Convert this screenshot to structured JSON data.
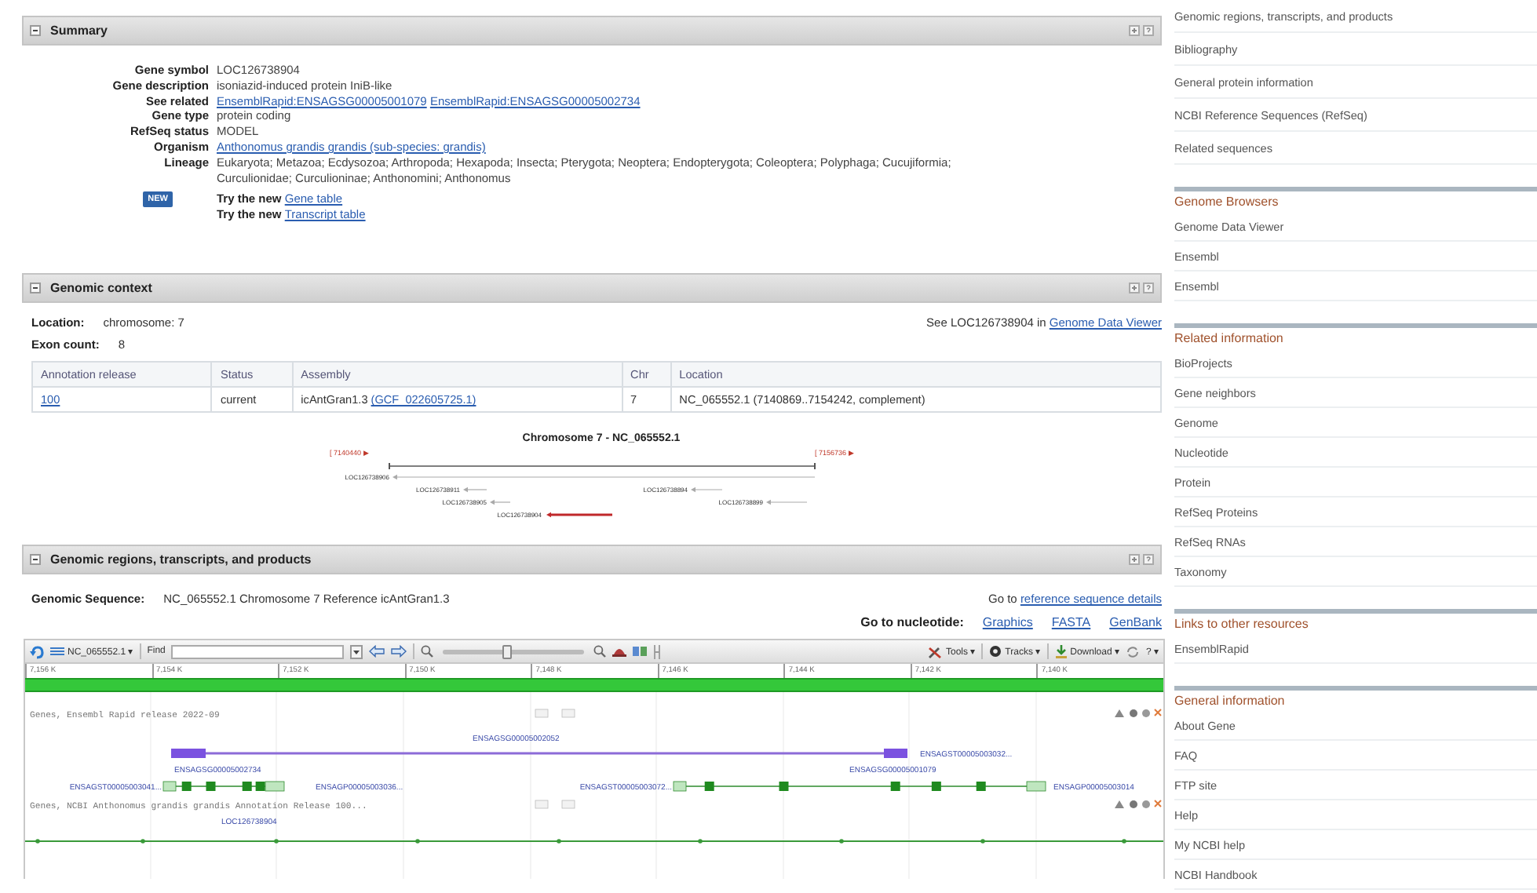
{
  "summary": {
    "title": "Summary",
    "fields": [
      {
        "label": "Gene symbol",
        "kind": "text",
        "value": "LOC126738904"
      },
      {
        "label": "Gene description",
        "kind": "text",
        "value": "isoniazid-induced protein IniB-like"
      },
      {
        "label": "See related",
        "kind": "links",
        "links": [
          "EnsemblRapid:ENSAGSG00005001079",
          "EnsemblRapid:ENSAGSG00005002734"
        ]
      },
      {
        "label": "Gene type",
        "kind": "text",
        "value": "protein coding"
      },
      {
        "label": "RefSeq status",
        "kind": "text",
        "value": "MODEL"
      },
      {
        "label": "Organism",
        "kind": "links",
        "links": [
          "Anthonomus grandis grandis (sub-species: grandis)"
        ]
      },
      {
        "label": "Lineage",
        "kind": "text",
        "value": "Eukaryota; Metazoa; Ecdysozoa; Arthropoda; Hexapoda; Insecta; Pterygota; Neoptera; Endopterygota; Coleoptera; Polyphaga; Cucujiformia; Curculionidae; Curculioninae; Anthonomini; Anthonomus"
      }
    ],
    "badge": "NEW",
    "try_links": [
      {
        "prefix": "Try the new",
        "link": "Gene table"
      },
      {
        "prefix": "Try the new",
        "link": "Transcript table"
      }
    ]
  },
  "genomic_context": {
    "title": "Genomic context",
    "location_label": "Location:",
    "location": "chromosome: 7",
    "exon_label": "Exon count:",
    "exon_count": "8",
    "see_text": "See LOC126738904 in",
    "see_link": "Genome Data Viewer",
    "table": {
      "columns": [
        "Annotation release",
        "Status",
        "Assembly",
        "Chr",
        "Location"
      ],
      "rows": [
        {
          "release": "100",
          "status": "current",
          "assembly": "icAntGran1.3",
          "assembly_link": "(GCF_022605725.1)",
          "chr": "7",
          "location": "NC_065552.1 (7140869..7154242, complement)"
        }
      ]
    },
    "diagram": {
      "title": "Chromosome 7 - NC_065552.1",
      "left_range": "[ 7140440 ▶",
      "right_range": "[ 7156736 ▶",
      "genes": [
        {
          "label": "LOC126738906",
          "selected": false
        },
        {
          "label": "LOC126738911",
          "selected": false
        },
        {
          "label": "LOC126738894",
          "selected": false
        },
        {
          "label": "LOC126738905",
          "selected": false
        },
        {
          "label": "LOC126738899",
          "selected": false
        },
        {
          "label": "LOC126738904",
          "selected": true
        }
      ]
    }
  },
  "genomic_regions": {
    "title": "Genomic regions, transcripts, and products",
    "seq_label": "Genomic Sequence:",
    "seq_value": "NC_065552.1 Chromosome 7 Reference icAntGran1.3",
    "goto_prefix": "Go to",
    "goto_link": "reference sequence details",
    "nuc_label": "Go to nucleotide:",
    "nuc_links": [
      "Graphics",
      "FASTA",
      "GenBank"
    ],
    "viewer": {
      "sequence_menu": "NC_065552.1 ▾",
      "find_label": "Find",
      "zoom_slider": {
        "level": 0.45
      },
      "menus": [
        {
          "kind": "tools",
          "label": "Tools ▾"
        },
        {
          "kind": "tracks",
          "label": "Tracks ▾"
        },
        {
          "kind": "download",
          "label": "Download ▾"
        },
        {
          "kind": "help",
          "label": "? ▾"
        }
      ],
      "ruler": [
        "7,156 K",
        "7,154 K",
        "7,152 K",
        "7,150 K",
        "7,148 K",
        "7,146 K",
        "7,144 K",
        "7,142 K",
        "7,140 K"
      ],
      "tracks": [
        {
          "title": "Genes, Ensembl Rapid release 2022-09",
          "features": [
            {
              "kind": "gene",
              "label": "ENSAGSG00005002052",
              "end_label": "ENSAGST00005003032..."
            },
            {
              "kind": "mrna",
              "label": "ENSAGSG00005002734",
              "start_label": "ENSAGST00005003041...",
              "end_label": "ENSAGP00005003036..."
            },
            {
              "kind": "mrna",
              "label": "ENSAGSG00005001079",
              "start_label": "ENSAGST00005003072...",
              "end_label": "ENSAGP00005003014"
            }
          ]
        },
        {
          "title": "Genes, NCBI Anthonomus grandis grandis Annotation Release 100...",
          "features": [
            {
              "kind": "locus",
              "label": "LOC126738904"
            }
          ]
        }
      ]
    }
  },
  "sidebar": [
    {
      "items": [
        "Genomic regions, transcripts, and products",
        "Bibliography",
        "General protein information",
        "NCBI Reference Sequences (RefSeq)",
        "Related sequences"
      ]
    },
    {
      "heading": "Genome Browsers",
      "items": [
        "Genome Data Viewer",
        "Ensembl",
        "Ensembl"
      ]
    },
    {
      "heading": "Related information",
      "items": [
        "BioProjects",
        "Gene neighbors",
        "Genome",
        "Nucleotide",
        "Protein",
        "RefSeq Proteins",
        "RefSeq RNAs",
        "Taxonomy"
      ]
    },
    {
      "heading": "Links to other resources",
      "items": [
        "EnsemblRapid"
      ]
    },
    {
      "heading": "General information",
      "items": [
        "About Gene",
        "FAQ",
        "FTP site",
        "Help",
        "My NCBI help",
        "NCBI Handbook"
      ]
    }
  ]
}
